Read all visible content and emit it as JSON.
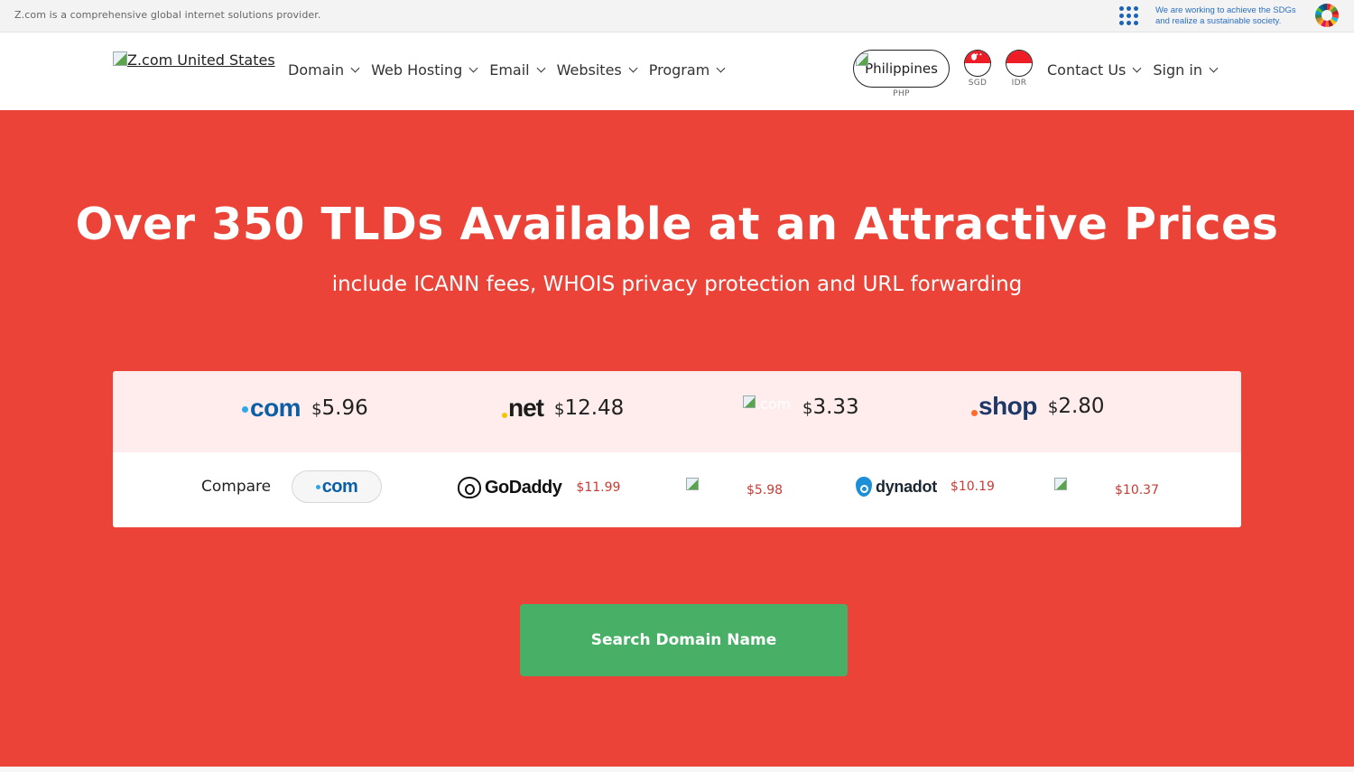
{
  "topbar": {
    "tagline": "Z.com is a comprehensive global internet solutions provider.",
    "sdg_line1": "We are working to achieve the SDGs",
    "sdg_line2": "and realize a sustainable society."
  },
  "header": {
    "logo_alt": "Z.com United States",
    "nav": [
      {
        "label": "Domain"
      },
      {
        "label": "Web Hosting"
      },
      {
        "label": "Email"
      },
      {
        "label": "Websites"
      },
      {
        "label": "Program"
      }
    ],
    "currencies": [
      {
        "name": "Philippines",
        "code": "PHP"
      },
      {
        "name": "Singapore",
        "code": "SGD"
      },
      {
        "name": "Indonesia",
        "code": "IDR"
      }
    ],
    "right_nav": [
      {
        "label": "Contact Us"
      },
      {
        "label": "Sign in"
      }
    ]
  },
  "hero": {
    "title": "Over 350 TLDs Available at an Attractive Prices",
    "subtitle": "include ICANN fees, WHOIS privacy protection and URL forwarding",
    "tlds": [
      {
        "name": "com",
        "currency": "$",
        "price": "5.96"
      },
      {
        "name": "net",
        "currency": "$",
        "price": "12.48"
      },
      {
        "name": ".com",
        "currency": "$",
        "price": "3.33"
      },
      {
        "name": "shop",
        "currency": "$",
        "price": "2.80"
      }
    ],
    "compare": {
      "label": "Compare",
      "tld": "com",
      "competitors": [
        {
          "name": "GoDaddy",
          "price": "$11.99"
        },
        {
          "name": "",
          "price": "$5.98"
        },
        {
          "name": "dynadot",
          "price": "$10.19"
        },
        {
          "name": "",
          "price": "$10.37"
        }
      ]
    },
    "search_button": "Search Domain Name"
  },
  "colors": {
    "hero_bg": "#eb4337",
    "search_button": "#48b066",
    "price_row_bg": "#ffecec",
    "competitor_price": "#c83a35",
    "com_blue": "#0b5fa5"
  }
}
